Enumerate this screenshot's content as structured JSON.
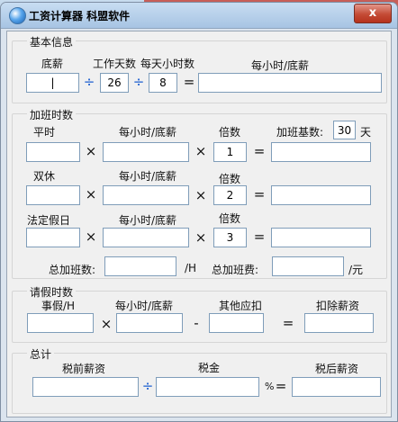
{
  "window": {
    "title": "工资计算器 科盟软件",
    "close_glyph": "x"
  },
  "basic": {
    "title": "基本信息",
    "base_salary_label": "底薪",
    "base_salary_value": "|",
    "workdays_label": "工作天数",
    "workdays_value": "26",
    "hours_label": "每天小时数",
    "hours_value": "8",
    "hourly_label": "每小时/底薪",
    "hourly_value": "",
    "div_op": "÷",
    "eq_op": "="
  },
  "overtime": {
    "title": "加班时数",
    "hourly_label": "每小时/底薪",
    "multiplier_label": "倍数",
    "base_label": "加班基数:",
    "base_value": "30",
    "base_unit": "天",
    "mul_op": "×",
    "eq_op": "=",
    "rows": [
      {
        "label": "平时",
        "multiplier": "1"
      },
      {
        "label": "双休",
        "multiplier": "2"
      },
      {
        "label": "法定假日",
        "multiplier": "3"
      }
    ],
    "total_count_label": "总加班数:",
    "total_count_unit": "/H",
    "total_fee_label": "总加班费:",
    "total_fee_unit": "/元"
  },
  "leave": {
    "title": "请假时数",
    "personal_label": "事假/H",
    "hourly_label": "每小时/底薪",
    "other_label": "其他应扣",
    "deduct_label": "扣除薪资",
    "mul_op": "×",
    "minus_op": "-",
    "eq_op": "="
  },
  "total": {
    "title": "总计",
    "pretax_label": "税前薪资",
    "tax_label": "税金",
    "aftertax_label": "税后薪资",
    "div_op": "÷",
    "pct": "%",
    "eq_op": "="
  }
}
